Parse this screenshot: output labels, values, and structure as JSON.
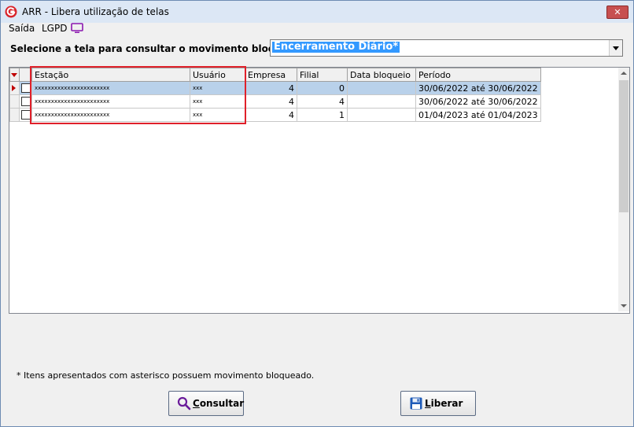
{
  "window": {
    "title": "ARR - Libera utilização de telas",
    "close_label": "✕"
  },
  "menu": {
    "items": [
      {
        "label": "Saída"
      },
      {
        "label": "LGPD"
      }
    ]
  },
  "filter": {
    "prompt": "Selecione a tela para consultar o movimento bloqueado :",
    "selected": "Encerramento Diário*"
  },
  "grid": {
    "columns": [
      "Estação",
      "Usuário",
      "Empresa",
      "Filial",
      "Data bloqueio",
      "Período"
    ],
    "rows": [
      {
        "estacao": "xxxxxxxxxxxxxxxxxxxxxxx",
        "usuario": "xxx",
        "empresa": "4",
        "filial": "0",
        "data_bloqueio": "",
        "periodo": "30/06/2022 até 30/06/2022",
        "selected": true
      },
      {
        "estacao": "xxxxxxxxxxxxxxxxxxxxxxx",
        "usuario": "xxx",
        "empresa": "4",
        "filial": "4",
        "data_bloqueio": "",
        "periodo": "30/06/2022 até 30/06/2022",
        "selected": false
      },
      {
        "estacao": "xxxxxxxxxxxxxxxxxxxxxxx",
        "usuario": "xxx",
        "empresa": "4",
        "filial": "1",
        "data_bloqueio": "",
        "periodo": "01/04/2023 até 01/04/2023",
        "selected": false
      }
    ]
  },
  "footer": {
    "note": "* Itens apresentados com asterisco possuem movimento bloqueado.",
    "consultar_label": "Consultar",
    "liberar_label": "Liberar"
  },
  "colors": {
    "selection": "#b9d1ea",
    "highlight_box": "#e0202a",
    "combo_selection": "#3399ff"
  }
}
